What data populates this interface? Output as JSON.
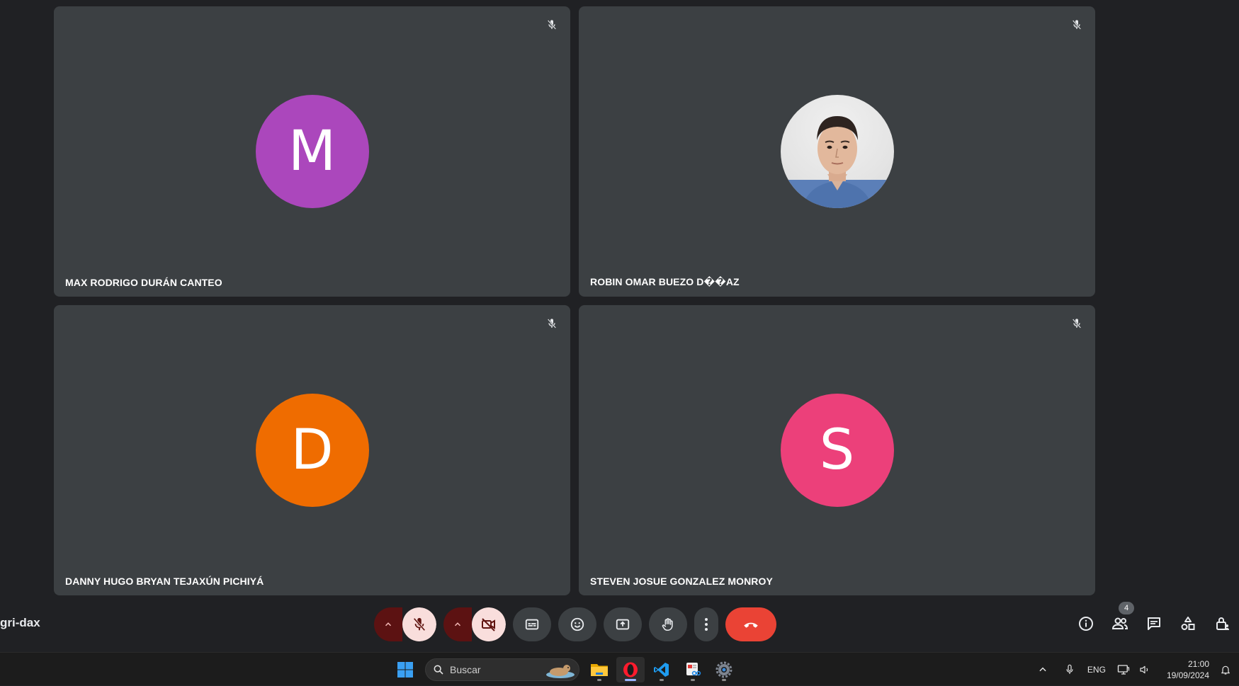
{
  "participants": [
    {
      "name": "MAX RODRIGO DURÁN CANTEO",
      "initial": "M",
      "color": "#ab47bc"
    },
    {
      "name": "ROBIN OMAR BUEZO D��AZ",
      "initial": "",
      "color": "#e8e8e8"
    },
    {
      "name": "DANNY HUGO BRYAN TEJAXÚN PICHIYÁ",
      "initial": "D",
      "color": "#ef6c00"
    },
    {
      "name": "STEVEN JOSUE GONZALEZ MONROY",
      "initial": "S",
      "color": "#ec407a"
    }
  ],
  "meeting": {
    "code": "gri-dax"
  },
  "toolbar": {
    "mic_state": "muted",
    "camera_state": "off",
    "icons": [
      "chevron-up-icon",
      "mic-off-icon",
      "chevron-up-icon",
      "camera-off-icon",
      "captions-icon",
      "emoji-icon",
      "present-icon",
      "raise-hand-icon",
      "more-icon",
      "end-call-icon"
    ]
  },
  "side_tools": {
    "people_count": "4"
  },
  "taskbar": {
    "search_placeholder": "Buscar",
    "language": "ENG",
    "time": "21:00",
    "date": "19/09/2024"
  }
}
